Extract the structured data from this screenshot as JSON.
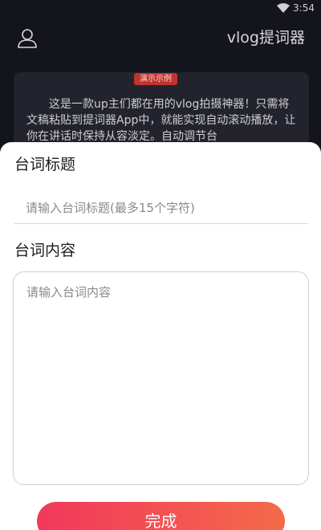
{
  "status_bar": {
    "time": "3:54",
    "icons": [
      "wifi-icon"
    ]
  },
  "header": {
    "title": "vlog提词器",
    "user_icon": "user-icon"
  },
  "demo_card": {
    "badge": "演示示例",
    "text": "这是一款up主们都在用的vlog拍摄神器！只需将文稿粘贴到提词器App中，就能实现自动滚动播放，让你在讲话时保持从容淡定。自动调节台"
  },
  "form": {
    "title_label": "台词标题",
    "title_placeholder": "请输入台词标题(最多15个字符)",
    "content_label": "台词内容",
    "content_placeholder": "请输入台词内容",
    "submit_label": "完成"
  },
  "colors": {
    "background": "#14141c",
    "card": "#23232d",
    "badge": "#c2342e",
    "button_gradient_start": "#f2385c",
    "button_gradient_end": "#f46a4a"
  }
}
